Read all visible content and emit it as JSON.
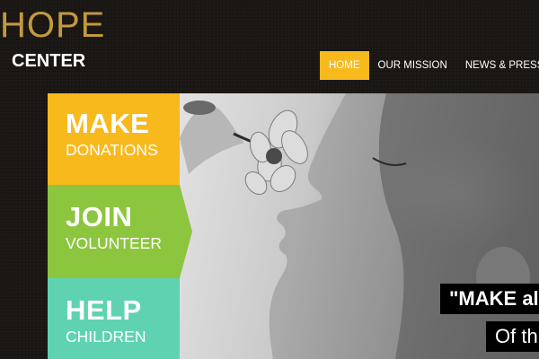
{
  "logo": {
    "hope": "HOPE",
    "center": "CENTER"
  },
  "nav": {
    "items": [
      {
        "label": "HOME",
        "active": true
      },
      {
        "label": "OUR MISSION",
        "active": false
      },
      {
        "label": "NEWS & PRESS",
        "active": false
      }
    ]
  },
  "tiles": {
    "make": {
      "title": "MAKE",
      "subtitle": "DONATIONS",
      "color": "#f8b91d"
    },
    "join": {
      "title": "JOIN",
      "subtitle": "VOLUNTEER",
      "color": "#8cc63f"
    },
    "help": {
      "title": "HELP",
      "subtitle": "CHILDREN",
      "color": "#5fd3b1"
    }
  },
  "hero": {
    "quote_line1": "\"MAKE al",
    "quote_line2": "Of th"
  },
  "colors": {
    "background": "#1c1816",
    "accent": "#f8b91d",
    "logo": "#c29a3f"
  }
}
